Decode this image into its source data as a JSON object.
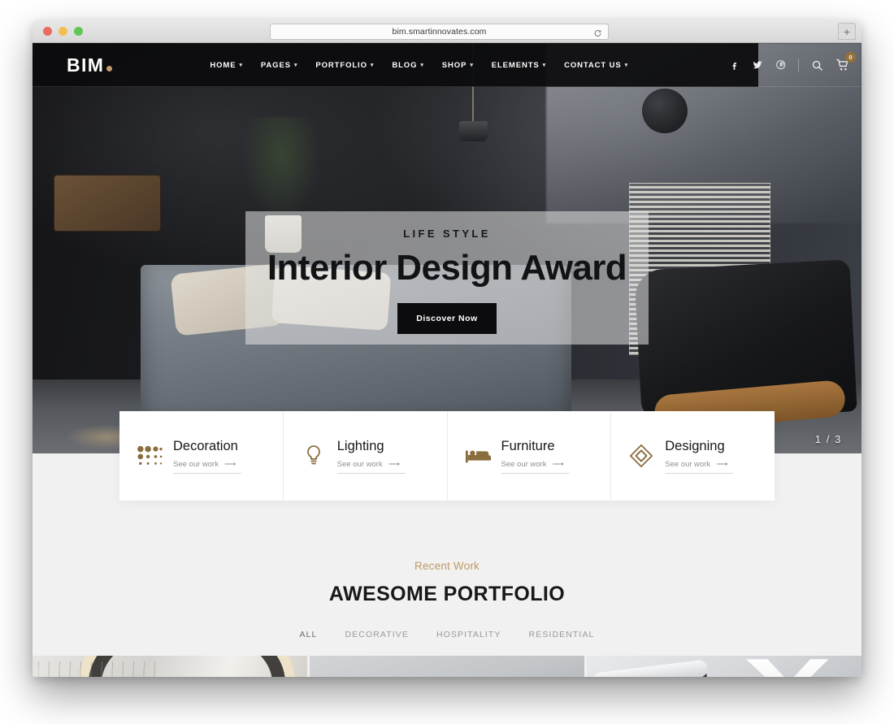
{
  "browser": {
    "url": "bim.smartinnovates.com",
    "reload_icon": "reload-icon",
    "newtab_label": "+"
  },
  "site": {
    "logo_text": "BIM",
    "nav": [
      {
        "label": "HOME",
        "has_caret": true
      },
      {
        "label": "PAGES",
        "has_caret": true
      },
      {
        "label": "PORTFOLIO",
        "has_caret": true
      },
      {
        "label": "BLOG",
        "has_caret": true
      },
      {
        "label": "SHOP",
        "has_caret": true
      },
      {
        "label": "ELEMENTS",
        "has_caret": true
      },
      {
        "label": "CONTACT US",
        "has_caret": true
      }
    ],
    "social": [
      {
        "name": "facebook-icon"
      },
      {
        "name": "twitter-icon"
      },
      {
        "name": "pinterest-icon"
      }
    ],
    "search_icon": "search-icon",
    "cart_icon": "cart-icon",
    "cart_count": "0"
  },
  "hero": {
    "kicker": "LIFE STYLE",
    "title": "Interior Design Award",
    "button_label": "Discover Now",
    "slide_counter": "1 / 3"
  },
  "services": [
    {
      "icon": "dots-grid-icon",
      "title": "Decoration",
      "link_label": "See our work"
    },
    {
      "icon": "lightbulb-icon",
      "title": "Lighting",
      "link_label": "See our work"
    },
    {
      "icon": "bed-icon",
      "title": "Furniture",
      "link_label": "See our work"
    },
    {
      "icon": "cube-icon",
      "title": "Designing",
      "link_label": "See our work"
    }
  ],
  "portfolio": {
    "kicker": "Recent Work",
    "title": "AWESOME PORTFOLIO",
    "filters": [
      {
        "label": "ALL",
        "active": true
      },
      {
        "label": "DECORATIVE",
        "active": false
      },
      {
        "label": "HOSPITALITY",
        "active": false
      },
      {
        "label": "RESIDENTIAL",
        "active": false
      }
    ],
    "tiles": [
      {
        "name": "portfolio-tile-1"
      },
      {
        "name": "portfolio-tile-2"
      },
      {
        "name": "portfolio-tile-3"
      }
    ]
  },
  "colors": {
    "accent_gold": "#bd9a62",
    "icon_gold": "#8a6d3d",
    "dark": "#0c0c0e",
    "page_bg": "#f1f1f1"
  }
}
